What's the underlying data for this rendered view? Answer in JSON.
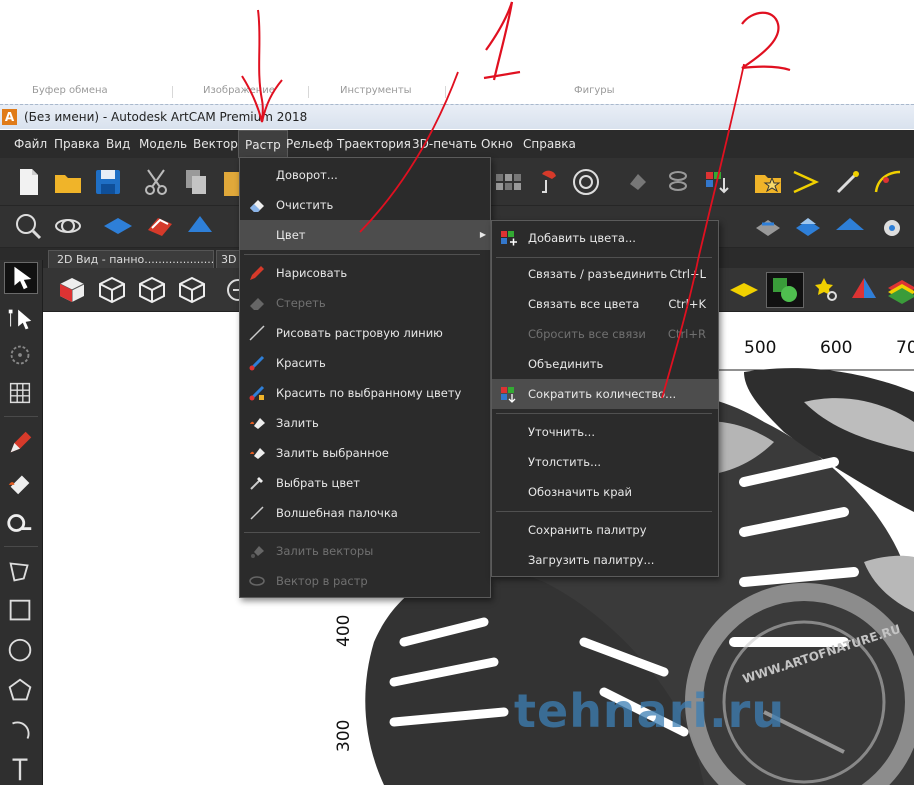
{
  "ribbon_groups": [
    "Буфер обмена",
    "Изображение",
    "Инструменты",
    "Фигуры"
  ],
  "window": {
    "title": "(Без имени) - Autodesk ArtCAM Premium 2018",
    "logo_letter": "A"
  },
  "menubar": [
    "Файл",
    "Правка",
    "Вид",
    "Модель",
    "Вектор",
    "Растр",
    "Рельеф",
    "Траектория",
    "3D-печать",
    "Окно",
    "Справка"
  ],
  "active_menu": "Растр",
  "tabs": [
    "2D Вид - панно.........................",
    "3D"
  ],
  "raster_menu": {
    "items": [
      {
        "label": "Доворот...",
        "disabled": false
      },
      {
        "label": "Очистить",
        "disabled": false
      },
      {
        "label": "Цвет",
        "disabled": false,
        "submenu": true,
        "highlighted": true
      },
      {
        "label": "Нарисовать",
        "disabled": false
      },
      {
        "label": "Стереть",
        "disabled": true
      },
      {
        "label": "Рисовать растровую линию",
        "disabled": false
      },
      {
        "label": "Красить",
        "disabled": false
      },
      {
        "label": "Красить по выбранному цвету",
        "disabled": false
      },
      {
        "label": "Залить",
        "disabled": false
      },
      {
        "label": "Залить выбранное",
        "disabled": false
      },
      {
        "label": "Выбрать цвет",
        "disabled": false
      },
      {
        "label": "Волшебная палочка",
        "disabled": false
      },
      {
        "label": "Залить векторы",
        "disabled": true
      },
      {
        "label": "Вектор в растр",
        "disabled": true
      }
    ]
  },
  "color_submenu": {
    "items": [
      {
        "label": "Добавить цвета...",
        "shortcut": "",
        "disabled": false
      },
      {
        "label": "Связать / разъединить",
        "shortcut": "Ctrl+L",
        "disabled": false
      },
      {
        "label": "Связать все цвета",
        "shortcut": "Ctrl+K",
        "disabled": false
      },
      {
        "label": "Сбросить все связи",
        "shortcut": "Ctrl+R",
        "disabled": true
      },
      {
        "label": "Объединить",
        "shortcut": "",
        "disabled": false
      },
      {
        "label": "Сократить количество...",
        "shortcut": "",
        "disabled": false,
        "highlighted": true
      },
      {
        "label": "Уточнить...",
        "shortcut": "",
        "disabled": false
      },
      {
        "label": "Утолстить...",
        "shortcut": "",
        "disabled": false
      },
      {
        "label": "Обозначить край",
        "shortcut": "",
        "disabled": false
      },
      {
        "label": "Сохранить палитру",
        "shortcut": "",
        "disabled": false
      },
      {
        "label": "Загрузить палитру...",
        "shortcut": "",
        "disabled": false
      }
    ]
  },
  "ruler": {
    "top": [
      "500",
      "600",
      "70"
    ],
    "left": [
      "400",
      "300"
    ]
  },
  "annotations": [
    "1",
    "2"
  ],
  "watermark": {
    "text": "tehnari.ru",
    "seal": "WWW.ARTOFNATURE.RU"
  },
  "colors": {
    "menubar_bg": "#2b2b2b",
    "toolbar_bg": "#323232",
    "highlight": "#4d4d4d",
    "annotation_red": "#e01020",
    "watermark_blue": "#3d7fb5"
  }
}
